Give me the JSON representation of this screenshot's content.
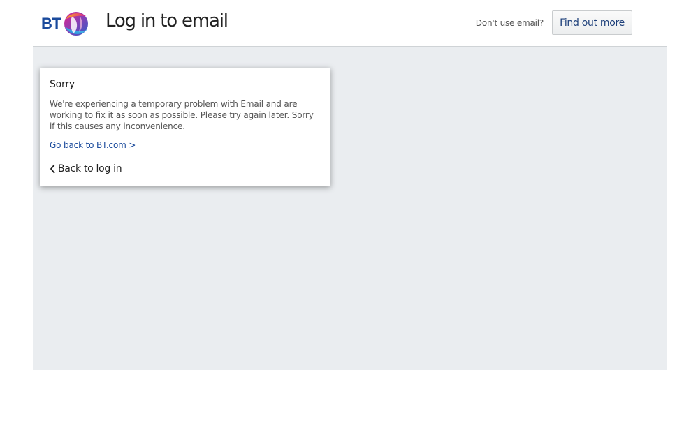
{
  "header": {
    "logo_text": "BT",
    "title": "Log in to email",
    "dont_use_text": "Don't use email?",
    "find_out_label": "Find out more"
  },
  "card": {
    "title": "Sorry",
    "message": "We're experiencing a temporary problem with Email and are working to fix it as soon as possible. Please try again later. Sorry if this causes any inconvenience.",
    "link_text": "Go back to BT.com >",
    "back_label": "Back to log in"
  },
  "icons": {
    "logo": "bt-globe-icon",
    "back": "chevron-left-icon"
  },
  "colors": {
    "brand_blue": "#1a4a9c",
    "main_bg": "#eaedf0"
  }
}
